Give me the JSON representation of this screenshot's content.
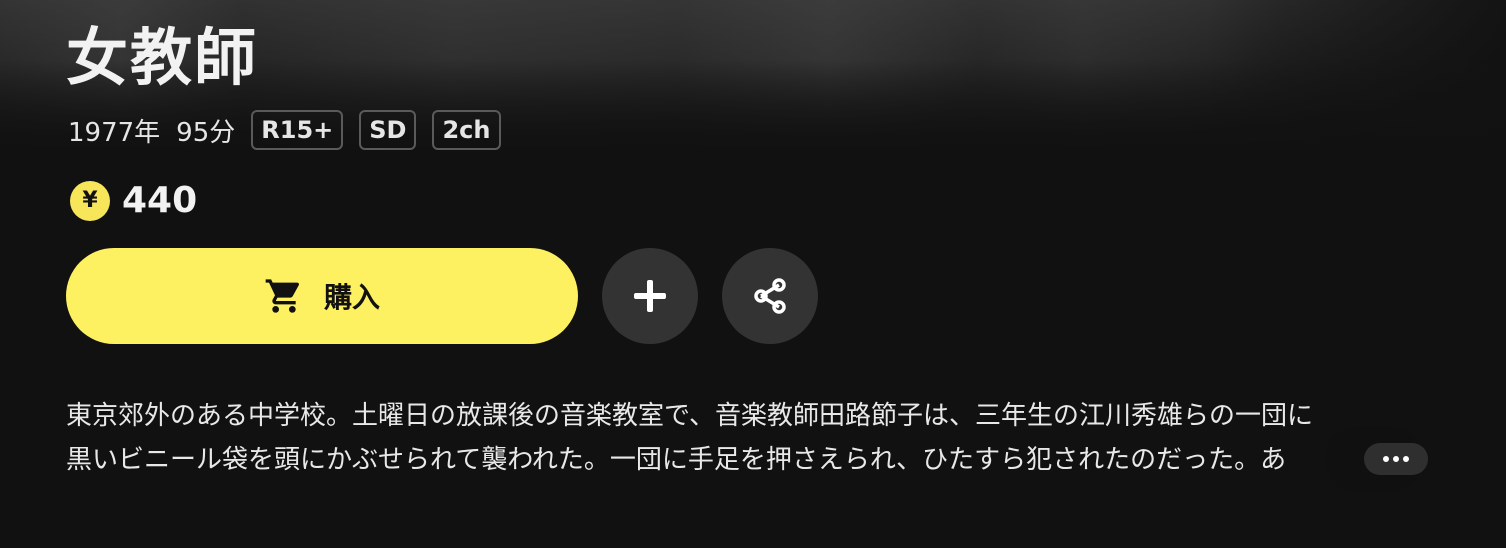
{
  "title": "女教師",
  "meta": {
    "year": "1977年",
    "duration": "95分",
    "badges": [
      "R15+",
      "SD",
      "2ch"
    ]
  },
  "price": {
    "currency_icon": "yen-coin-icon",
    "currency_symbol": "¥",
    "value": "440"
  },
  "actions": {
    "buy_label": "購入",
    "buy_icon": "cart-icon",
    "add_icon": "plus-icon",
    "share_icon": "share-icon",
    "more_icon": "ellipsis-icon"
  },
  "description": {
    "line1": "東京郊外のある中学校。土曜日の放課後の音楽教室で、音楽教師田路節子は、三年生の江川秀雄らの一団に",
    "line2": "黒いビニール袋を頭にかぶせられて襲われた。一団に手足を押さえられ、ひたすら犯されたのだった。あ"
  },
  "colors": {
    "background": "#111111",
    "accent": "#fdf061",
    "round_button": "#333333"
  }
}
